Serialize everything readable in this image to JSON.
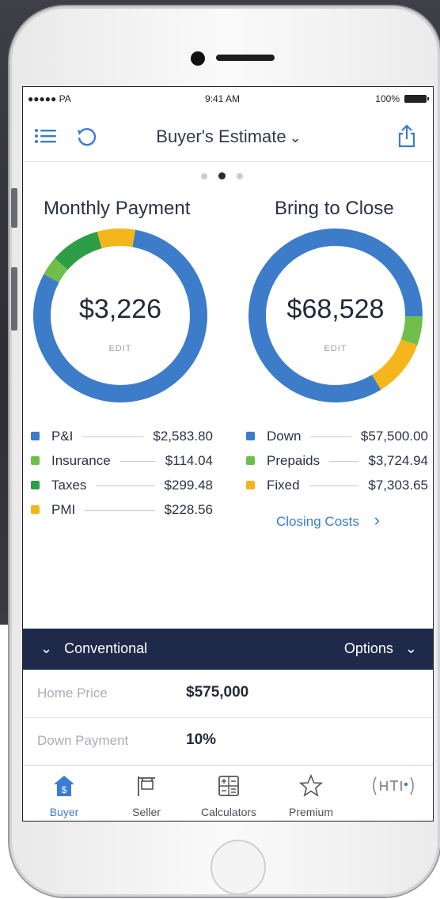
{
  "status_bar": {
    "carrier": "●●●●● PA",
    "time": "9:41 AM",
    "battery": "100%"
  },
  "nav": {
    "title": "Buyer's Estimate",
    "title_chevron": "⌄",
    "icons": [
      "list-icon",
      "refresh-icon",
      "share-icon"
    ]
  },
  "pager": {
    "pages": 3,
    "active_index": 1
  },
  "monthly": {
    "title": "Monthly Payment",
    "total": "$3,226",
    "edit_label": "EDIT",
    "ring": [
      {
        "label": "P&I",
        "fraction": 0.801,
        "color": "#3d7cc9"
      },
      {
        "label": "Insurance",
        "fraction": 0.035,
        "color": "#6fbf4a"
      },
      {
        "label": "Taxes",
        "fraction": 0.093,
        "color": "#2e9e46"
      },
      {
        "label": "PMI",
        "fraction": 0.071,
        "color": "#f5b51c"
      }
    ],
    "legend": [
      {
        "label": "P&I",
        "amount": "$2,583.80",
        "color": "#3d7cc9"
      },
      {
        "label": "Insurance",
        "amount": "$114.04",
        "color": "#6fbf4a"
      },
      {
        "label": "Taxes",
        "amount": "$299.48",
        "color": "#2e9e46"
      },
      {
        "label": "PMI",
        "amount": "$228.56",
        "color": "#f5b51c"
      }
    ]
  },
  "close": {
    "title": "Bring to Close",
    "total": "$68,528",
    "edit_label": "EDIT",
    "ring": [
      {
        "label": "Fixed",
        "fraction": 0.107,
        "color": "#f5b51c"
      },
      {
        "label": "Down",
        "fraction": 0.839,
        "color": "#3d7cc9"
      },
      {
        "label": "Prepaids",
        "fraction": 0.054,
        "color": "#6fbf4a"
      }
    ],
    "legend": [
      {
        "label": "Down",
        "amount": "$57,500.00",
        "color": "#3d7cc9"
      },
      {
        "label": "Prepaids",
        "amount": "$3,724.94",
        "color": "#6fbf4a"
      },
      {
        "label": "Fixed",
        "amount": "$7,303.65",
        "color": "#f5b51c"
      }
    ],
    "link": "Closing Costs",
    "link_chevron": "›"
  },
  "loan_bar": {
    "type_chevron": "⌄",
    "type": "Conventional",
    "options": "Options",
    "options_chevron": "⌄"
  },
  "details": [
    {
      "label": "Home Price",
      "value": "$575,000"
    },
    {
      "label": "Down Payment",
      "value": "10%"
    }
  ],
  "tabs": [
    {
      "label": "Buyer",
      "icon": "house-dollar-icon",
      "active": true
    },
    {
      "label": "Seller",
      "icon": "sign-icon",
      "active": false
    },
    {
      "label": "Calculators",
      "icon": "calculator-icon",
      "active": false
    },
    {
      "label": "Premium",
      "icon": "star-icon",
      "active": false
    },
    {
      "label": "",
      "icon": "hti-logo-icon",
      "active": false
    }
  ],
  "colors": {
    "accent": "#3a7bd5",
    "dark_bar": "#1f2a4a"
  }
}
